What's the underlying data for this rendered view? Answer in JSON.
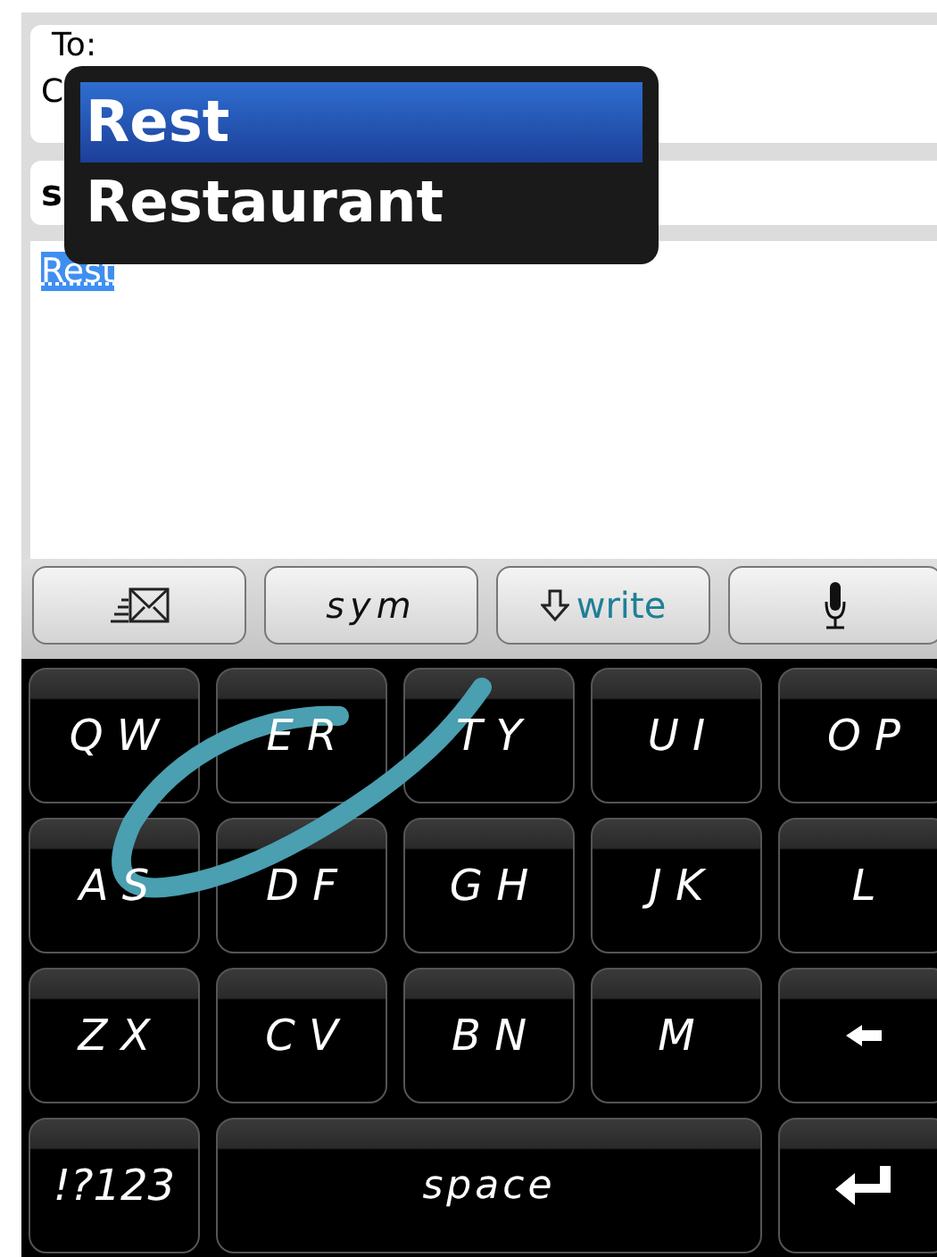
{
  "header": {
    "to_label": "To:",
    "cc_label": "C",
    "subject_label": "s"
  },
  "body": {
    "text": "Rest"
  },
  "suggestions": [
    {
      "label": "Rest",
      "selected": true
    },
    {
      "label": "Restaurant",
      "selected": false
    }
  ],
  "toolbar": [
    {
      "kind": "mail"
    },
    {
      "kind": "text",
      "label": "sym"
    },
    {
      "kind": "write",
      "label": "write"
    },
    {
      "kind": "mic"
    }
  ],
  "keyboard": {
    "rows": [
      [
        {
          "kind": "key",
          "label": "Q W"
        },
        {
          "kind": "key",
          "label": "E R"
        },
        {
          "kind": "key",
          "label": "T Y"
        },
        {
          "kind": "key",
          "label": "U I"
        },
        {
          "kind": "key",
          "label": "O P"
        }
      ],
      [
        {
          "kind": "key",
          "label": "A S"
        },
        {
          "kind": "key",
          "label": "D F"
        },
        {
          "kind": "key",
          "label": "G H"
        },
        {
          "kind": "key",
          "label": "J K"
        },
        {
          "kind": "key",
          "label": "L"
        }
      ],
      [
        {
          "kind": "key",
          "label": "Z X"
        },
        {
          "kind": "key",
          "label": "C V"
        },
        {
          "kind": "key",
          "label": "B N"
        },
        {
          "kind": "key",
          "label": "M"
        },
        {
          "kind": "backspace"
        }
      ]
    ],
    "bottom_row": {
      "symbols_key": "!?123",
      "space_key": "space"
    }
  }
}
